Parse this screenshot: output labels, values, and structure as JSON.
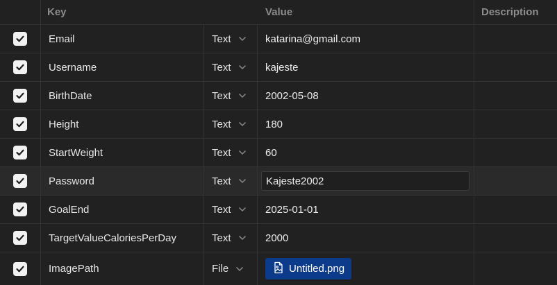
{
  "header": {
    "key": "Key",
    "value": "Value",
    "description": "Description"
  },
  "rows": [
    {
      "key": "Email",
      "type": "Text",
      "value": "katarina@gmail.com",
      "checked": true
    },
    {
      "key": "Username",
      "type": "Text",
      "value": "kajeste",
      "checked": true
    },
    {
      "key": "BirthDate",
      "type": "Text",
      "value": "2002-05-08",
      "checked": true
    },
    {
      "key": "Height",
      "type": "Text",
      "value": "180",
      "checked": true
    },
    {
      "key": "StartWeight",
      "type": "Text",
      "value": "60",
      "checked": true
    },
    {
      "key": "Password",
      "type": "Text",
      "value": "Kajeste2002",
      "checked": true
    },
    {
      "key": "GoalEnd",
      "type": "Text",
      "value": "2025-01-01",
      "checked": true
    },
    {
      "key": "TargetValueCaloriesPerDay",
      "type": "Text",
      "value": "2000",
      "checked": true
    },
    {
      "key": "ImagePath",
      "type": "File",
      "value": "Untitled.png",
      "checked": true
    }
  ],
  "icons": {
    "checkbox": "check-icon",
    "dropdown": "chevron-down-icon",
    "file": "file-image-icon"
  },
  "colors": {
    "background": "#212121",
    "checkbox": "#f2f2f2",
    "file_chip": "#0d3b8c"
  }
}
